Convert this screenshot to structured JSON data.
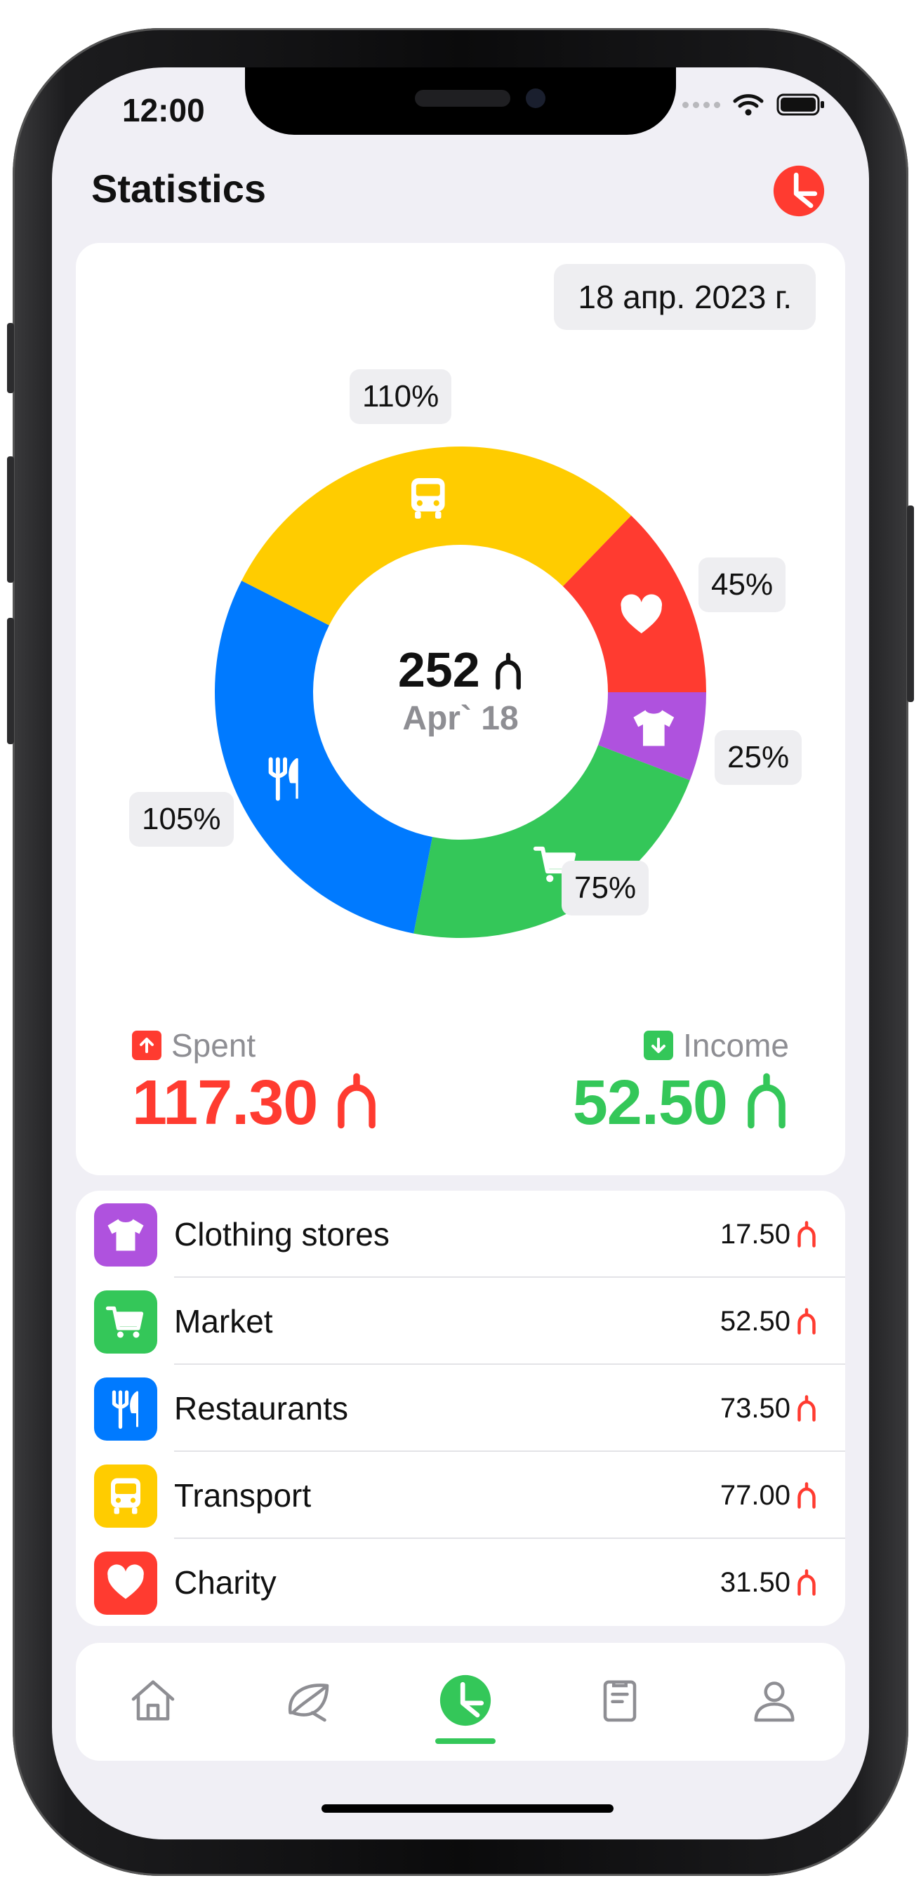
{
  "status_bar": {
    "time": "12:00"
  },
  "header": {
    "title": "Statistics"
  },
  "date_picker": {
    "value": "18 апр. 2023 г."
  },
  "center": {
    "total": "252",
    "date": "Apr` 18"
  },
  "currency_symbol": "₼",
  "chart_data": {
    "type": "pie",
    "slices": [
      {
        "category": "Charity",
        "icon": "heart-icon",
        "color": "#ff3b30",
        "label": "45%"
      },
      {
        "category": "Clothing stores",
        "icon": "tshirt-icon",
        "color": "#af52de",
        "label": "25%"
      },
      {
        "category": "Market",
        "icon": "cart-icon",
        "color": "#34c759",
        "label": "75%"
      },
      {
        "category": "Restaurants",
        "icon": "fork-knife-icon",
        "color": "#007aff",
        "label": "105%"
      },
      {
        "category": "Transport",
        "icon": "bus-icon",
        "color": "#ffcc00",
        "label": "110%"
      }
    ]
  },
  "spent": {
    "label": "Spent",
    "value": "117.30",
    "color": "#ff3b30"
  },
  "income": {
    "label": "Income",
    "value": "52.50",
    "color": "#34c759"
  },
  "categories": [
    {
      "name": "Clothing stores",
      "amount": "17.50",
      "icon": "tshirt-icon",
      "color": "#af52de"
    },
    {
      "name": "Market",
      "amount": "52.50",
      "icon": "cart-icon",
      "color": "#34c759"
    },
    {
      "name": "Restaurants",
      "amount": "73.50",
      "icon": "fork-knife-icon",
      "color": "#007aff"
    },
    {
      "name": "Transport",
      "amount": "77.00",
      "icon": "bus-icon",
      "color": "#ffcc00"
    },
    {
      "name": "Charity",
      "amount": "31.50",
      "icon": "heart-icon",
      "color": "#ff3b30"
    }
  ],
  "tabs": [
    {
      "icon": "home-icon",
      "active": false
    },
    {
      "icon": "leaf-icon",
      "active": false
    },
    {
      "icon": "pie-chart-icon",
      "active": true
    },
    {
      "icon": "clipboard-icon",
      "active": false
    },
    {
      "icon": "person-icon",
      "active": false
    }
  ],
  "accent_color": "#34c759"
}
